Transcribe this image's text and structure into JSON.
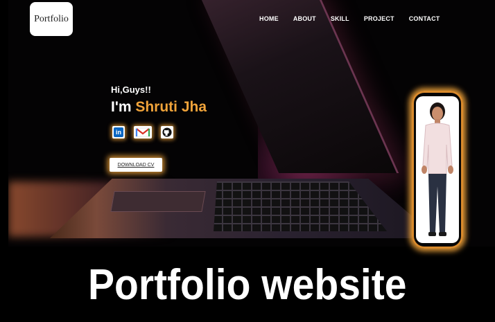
{
  "logo": {
    "text": "Portfolio"
  },
  "nav": {
    "items": [
      {
        "label": "HOME"
      },
      {
        "label": "ABOUT"
      },
      {
        "label": "SKILL"
      },
      {
        "label": "PROJECT"
      },
      {
        "label": "CONTACT"
      }
    ]
  },
  "hero": {
    "greeting": "Hi,Guys!!",
    "intro_prefix": "I'm ",
    "intro_name": "Shruti Jha",
    "accent_color": "#f0a33a",
    "socials": [
      {
        "icon": "linkedin-icon",
        "label": "in"
      },
      {
        "icon": "gmail-icon",
        "label": "M"
      },
      {
        "icon": "github-icon",
        "label": ""
      }
    ],
    "cv_button": "DOWNLOAD CV"
  },
  "caption": {
    "text": "Portfolio website"
  }
}
